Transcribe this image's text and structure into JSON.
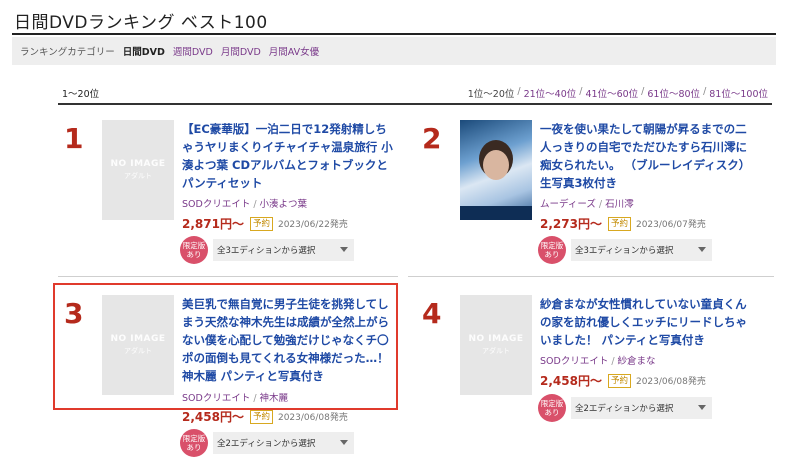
{
  "page": {
    "title": "日間DVDランキング ベスト100"
  },
  "categories": {
    "label": "ランキングカテゴリー",
    "items": [
      {
        "label": "日間DVD",
        "active": true
      },
      {
        "label": "週間DVD",
        "active": false
      },
      {
        "label": "月間DVD",
        "active": false
      },
      {
        "label": "月間AV女優",
        "active": false
      }
    ]
  },
  "range": {
    "current": "1～20位",
    "nav": [
      "1位～20位",
      "21位～40位",
      "41位～60位",
      "61位～80位",
      "81位～100位"
    ],
    "separator": "/"
  },
  "no_image": {
    "line1": "NO IMAGE",
    "line2": "アダルト"
  },
  "limited_badge": {
    "line1": "限定版",
    "line2": "あり"
  },
  "items": [
    {
      "rank": "1",
      "title": "【EC豪華版】一泊二日で12発射精しちゃうヤリまくりイチャイチャ温泉旅行 小湊よつ葉 CDアルバムとフォトブックとパンティセット",
      "maker": "SODクリエイト",
      "actress": "小湊よつ葉",
      "price": "2,871円～",
      "badge": "予約",
      "date": "2023/06/22発売",
      "edition": "全3エディションから選択",
      "has_image": false
    },
    {
      "rank": "2",
      "title": "一夜を使い果たして朝陽が昇るまでの二人っきりの自宅でただひたすら石川澪に痴女られたい。 （ブルーレイディスク） 生写真3枚付き",
      "maker": "ムーディーズ",
      "actress": "石川澪",
      "price": "2,273円～",
      "badge": "予約",
      "date": "2023/06/07発売",
      "edition": "全3エディションから選択",
      "has_image": true
    },
    {
      "rank": "3",
      "title": "美巨乳で無自覚に男子生徒を挑発してしまう天然な神木先生は成績が全然上がらない僕を心配して勉強だけじゃなくチ〇ポの面倒も見てくれる女神様だった…！ 神木麗 パンティと写真付き",
      "maker": "SODクリエイト",
      "actress": "神木麗",
      "price": "2,458円～",
      "badge": "予約",
      "date": "2023/06/08発売",
      "edition": "全2エディションから選択",
      "has_image": false
    },
    {
      "rank": "4",
      "title": "紗倉まなが女性慣れしていない童貞くんの家を訪れ優しくエッチにリードしちゃいました！ パンティと写真付き",
      "maker": "SODクリエイト",
      "actress": "紗倉まな",
      "price": "2,458円～",
      "badge": "予約",
      "date": "2023/06/08発売",
      "edition": "全2エディションから選択",
      "has_image": false
    }
  ],
  "colors": {
    "rank": "#b52a1c",
    "title_link": "#1f4aa5",
    "maker_link": "#7a3a8a",
    "price": "#b52a1c",
    "highlight": "#e03a2c",
    "limited_badge": "#d9506a"
  }
}
